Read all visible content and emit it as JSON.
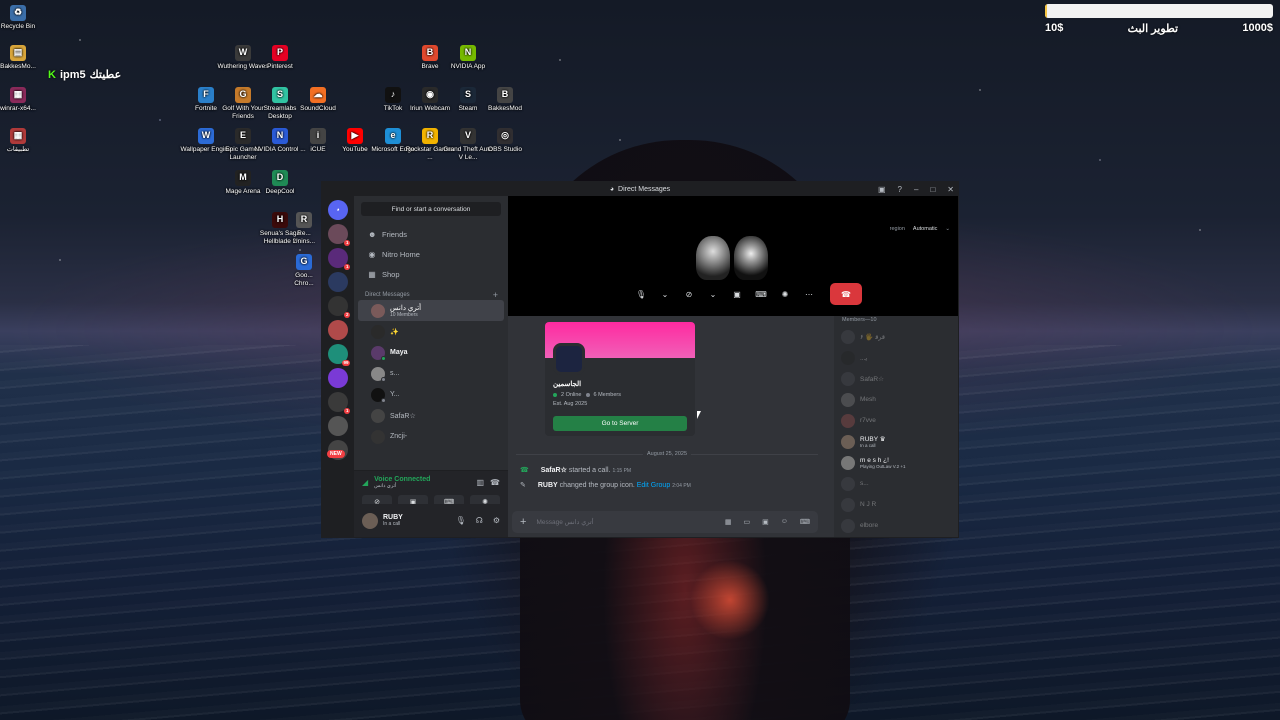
{
  "desktop_icons": [
    {
      "label": "Recycle Bin",
      "glyph": "♻",
      "color": "#3b6ea8"
    },
    {
      "label": "BakkesMo...",
      "glyph": "▤",
      "color": "#d8a53a"
    },
    {
      "label": "winrar-x64...",
      "glyph": "▦",
      "color": "#8a2a5a"
    },
    {
      "label": "تطبيقات",
      "glyph": "▦",
      "color": "#b03a3a"
    },
    {
      "label": "Wuthering Waves",
      "glyph": "W",
      "color": "#3a3a3a"
    },
    {
      "label": "Pinterest",
      "glyph": "P",
      "color": "#e60023"
    },
    {
      "label": "Fortnite",
      "glyph": "F",
      "color": "#2a7fc9"
    },
    {
      "label": "Golf With Your Friends",
      "glyph": "G",
      "color": "#c57a2a"
    },
    {
      "label": "Streamlabs Desktop",
      "glyph": "S",
      "color": "#31c3a2"
    },
    {
      "label": "SoundCloud",
      "glyph": "☁",
      "color": "#f26f23"
    },
    {
      "label": "Wallpaper Engine",
      "glyph": "W",
      "color": "#2c6bd6"
    },
    {
      "label": "Epic Games Launcher",
      "glyph": "E",
      "color": "#2a2a2a"
    },
    {
      "label": "NVIDIA Control ...",
      "glyph": "N",
      "color": "#2a5ad6"
    },
    {
      "label": "iCUE",
      "glyph": "i",
      "color": "#444"
    },
    {
      "label": "YouTube",
      "glyph": "▶",
      "color": "#ff0000"
    },
    {
      "label": "Mage Arena",
      "glyph": "M",
      "color": "#222"
    },
    {
      "label": "DeepCool",
      "glyph": "D",
      "color": "#1f8a55"
    },
    {
      "label": "Senua's Saga Hellblade 2",
      "glyph": "H",
      "color": "#3a0a0a"
    },
    {
      "label": "Re... Unins...",
      "glyph": "R",
      "color": "#555"
    },
    {
      "label": "Goo... Chro...",
      "glyph": "G",
      "color": "#2a6ad6"
    },
    {
      "label": "Brave",
      "glyph": "B",
      "color": "#e0482d"
    },
    {
      "label": "NVIDIA App",
      "glyph": "N",
      "color": "#76b900"
    },
    {
      "label": "TikTok",
      "glyph": "♪",
      "color": "#111"
    },
    {
      "label": "Iriun Webcam",
      "glyph": "◉",
      "color": "#2a2a2a"
    },
    {
      "label": "Steam",
      "glyph": "S",
      "color": "#1b2838"
    },
    {
      "label": "BakkesMod",
      "glyph": "B",
      "color": "#444"
    },
    {
      "label": "Microsoft Edge",
      "glyph": "e",
      "color": "#1e8fd6"
    },
    {
      "label": "Rockstar Games ...",
      "glyph": "R",
      "color": "#f2b300"
    },
    {
      "label": "Grand Theft Auto V Le...",
      "glyph": "V",
      "color": "#333"
    },
    {
      "label": "OBS Studio",
      "glyph": "◎",
      "color": "#302e31"
    }
  ],
  "overlay": {
    "kick_label": "ipm5",
    "arabic_text": "عطيتك"
  },
  "goal": {
    "left": "10$",
    "title": "تطوير البث",
    "right": "1000$",
    "progress": 0.01
  },
  "window": {
    "title": "Direct Messages"
  },
  "search": {
    "label": "Find or start a conversation"
  },
  "nav": [
    {
      "label": "Friends",
      "icon": "friends-icon",
      "glyph": "☻"
    },
    {
      "label": "Nitro Home",
      "icon": "nitro-icon",
      "glyph": "◉"
    },
    {
      "label": "Shop",
      "icon": "shop-icon",
      "glyph": "▦"
    }
  ],
  "dm": {
    "header": "Direct Messages",
    "add": "+",
    "items": [
      {
        "name": "أتري دانس",
        "sub": "10 Members",
        "active": true
      },
      {
        "name": "✨",
        "sub": ""
      },
      {
        "name": "Maya",
        "sub": "",
        "bold": true
      },
      {
        "name": "s...",
        "sub": ""
      },
      {
        "name": "Y...",
        "sub": ""
      },
      {
        "name": "SafaR☆",
        "sub": ""
      },
      {
        "name": "Zncji-",
        "sub": ""
      }
    ]
  },
  "voice": {
    "status": "Voice Connected",
    "channel": "أتري دانس"
  },
  "user": {
    "name": "RUBY",
    "status": "In a call"
  },
  "stage": {
    "region_label": "region",
    "region_value": "Automatic"
  },
  "invite": {
    "name": "الجاسمين",
    "online": "2 Online",
    "members": "6 Members",
    "established": "Est. Aug 2025",
    "button": "Go to Server"
  },
  "date_separator": "August 25, 2025",
  "messages": [
    {
      "author": "SafaR☆",
      "text": "started a call.",
      "link": "",
      "time": "1:15 PM",
      "icon": "phone-icon"
    },
    {
      "author": "RUBY",
      "text": "changed the group icon.",
      "link": "Edit Group",
      "time": "2:04 PM",
      "icon": "pencil-icon"
    }
  ],
  "composer": {
    "placeholder": "Message أتري دانس"
  },
  "members": {
    "header": "Members—10",
    "items": [
      {
        "name": "۶ 🖐 ﻗﺮﻗ",
        "sub": "",
        "offline": true
      },
      {
        "name": "...ﻳ",
        "sub": "",
        "offline": true
      },
      {
        "name": "SafaR☆",
        "sub": "",
        "offline": true
      },
      {
        "name": "Mesh",
        "sub": "",
        "offline": true
      },
      {
        "name": "r7vve",
        "sub": "",
        "offline": true
      },
      {
        "name": "RUBY ♛",
        "sub": "In a call",
        "offline": false
      },
      {
        "name": "m e s h ¿!",
        "sub": "Playing OutLaw V.2 +1",
        "offline": false
      },
      {
        "name": "s...",
        "sub": "",
        "offline": true
      },
      {
        "name": "N J R",
        "sub": "",
        "offline": true
      },
      {
        "name": "elbore",
        "sub": "",
        "offline": true
      }
    ]
  },
  "colors": {
    "accent": "#5865f2",
    "online": "#23a55a",
    "danger": "#da373c",
    "invite_banner": "#ff2aa0"
  }
}
